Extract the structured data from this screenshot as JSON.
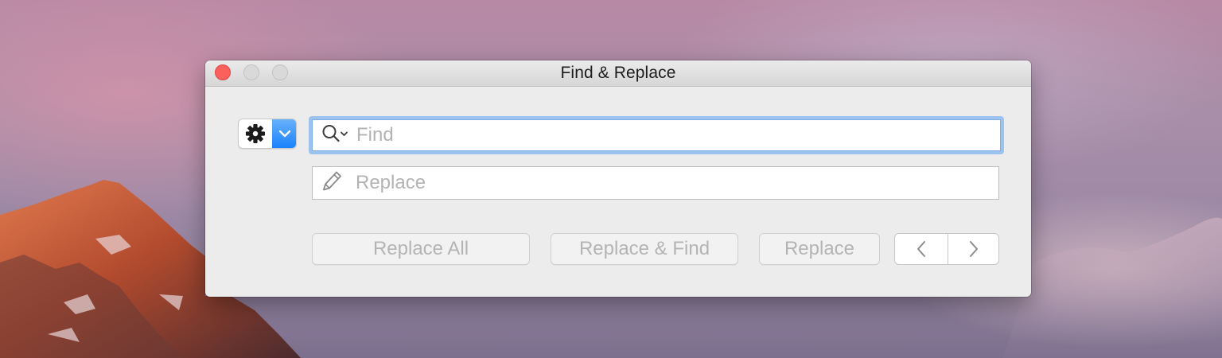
{
  "window": {
    "title": "Find & Replace"
  },
  "window_controls": {
    "close": "close",
    "minimize": "minimize",
    "zoom": "zoom"
  },
  "action_menu": {
    "icon": "gear-icon",
    "arrow_icon": "chevron-down-icon",
    "accent_color": "#1a82fb"
  },
  "find": {
    "value": "",
    "placeholder": "Find",
    "icon": "search-icon"
  },
  "replace": {
    "value": "",
    "placeholder": "Replace",
    "icon": "pencil-icon"
  },
  "buttons": {
    "replace_all": "Replace All",
    "replace_and_find": "Replace & Find",
    "replace": "Replace",
    "previous_icon": "chevron-left-icon",
    "next_icon": "chevron-right-icon"
  }
}
